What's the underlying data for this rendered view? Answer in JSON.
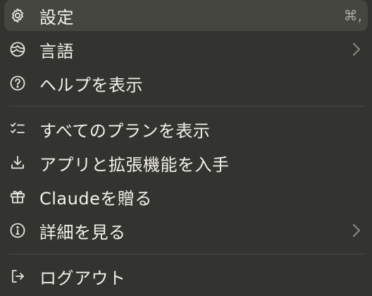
{
  "menu": {
    "items": [
      {
        "label": "設定",
        "icon": "gear-icon",
        "shortcut": "⌘,",
        "highlighted": true
      },
      {
        "label": "言語",
        "icon": "globe-icon",
        "submenu": true
      },
      {
        "label": "ヘルプを表示",
        "icon": "help-circle-icon"
      },
      {
        "label": "すべてのプランを表示",
        "icon": "checklist-icon"
      },
      {
        "label": "アプリと拡張機能を入手",
        "icon": "download-icon"
      },
      {
        "label": "Claudeを贈る",
        "icon": "gift-icon"
      },
      {
        "label": "詳細を見る",
        "icon": "info-circle-icon",
        "submenu": true
      },
      {
        "label": "ログアウト",
        "icon": "logout-icon"
      }
    ]
  },
  "colors": {
    "background": "#33332f",
    "highlight": "#464641",
    "text": "#f3f1ea",
    "muted": "#a9a79f",
    "divider": "#4d4c47"
  }
}
